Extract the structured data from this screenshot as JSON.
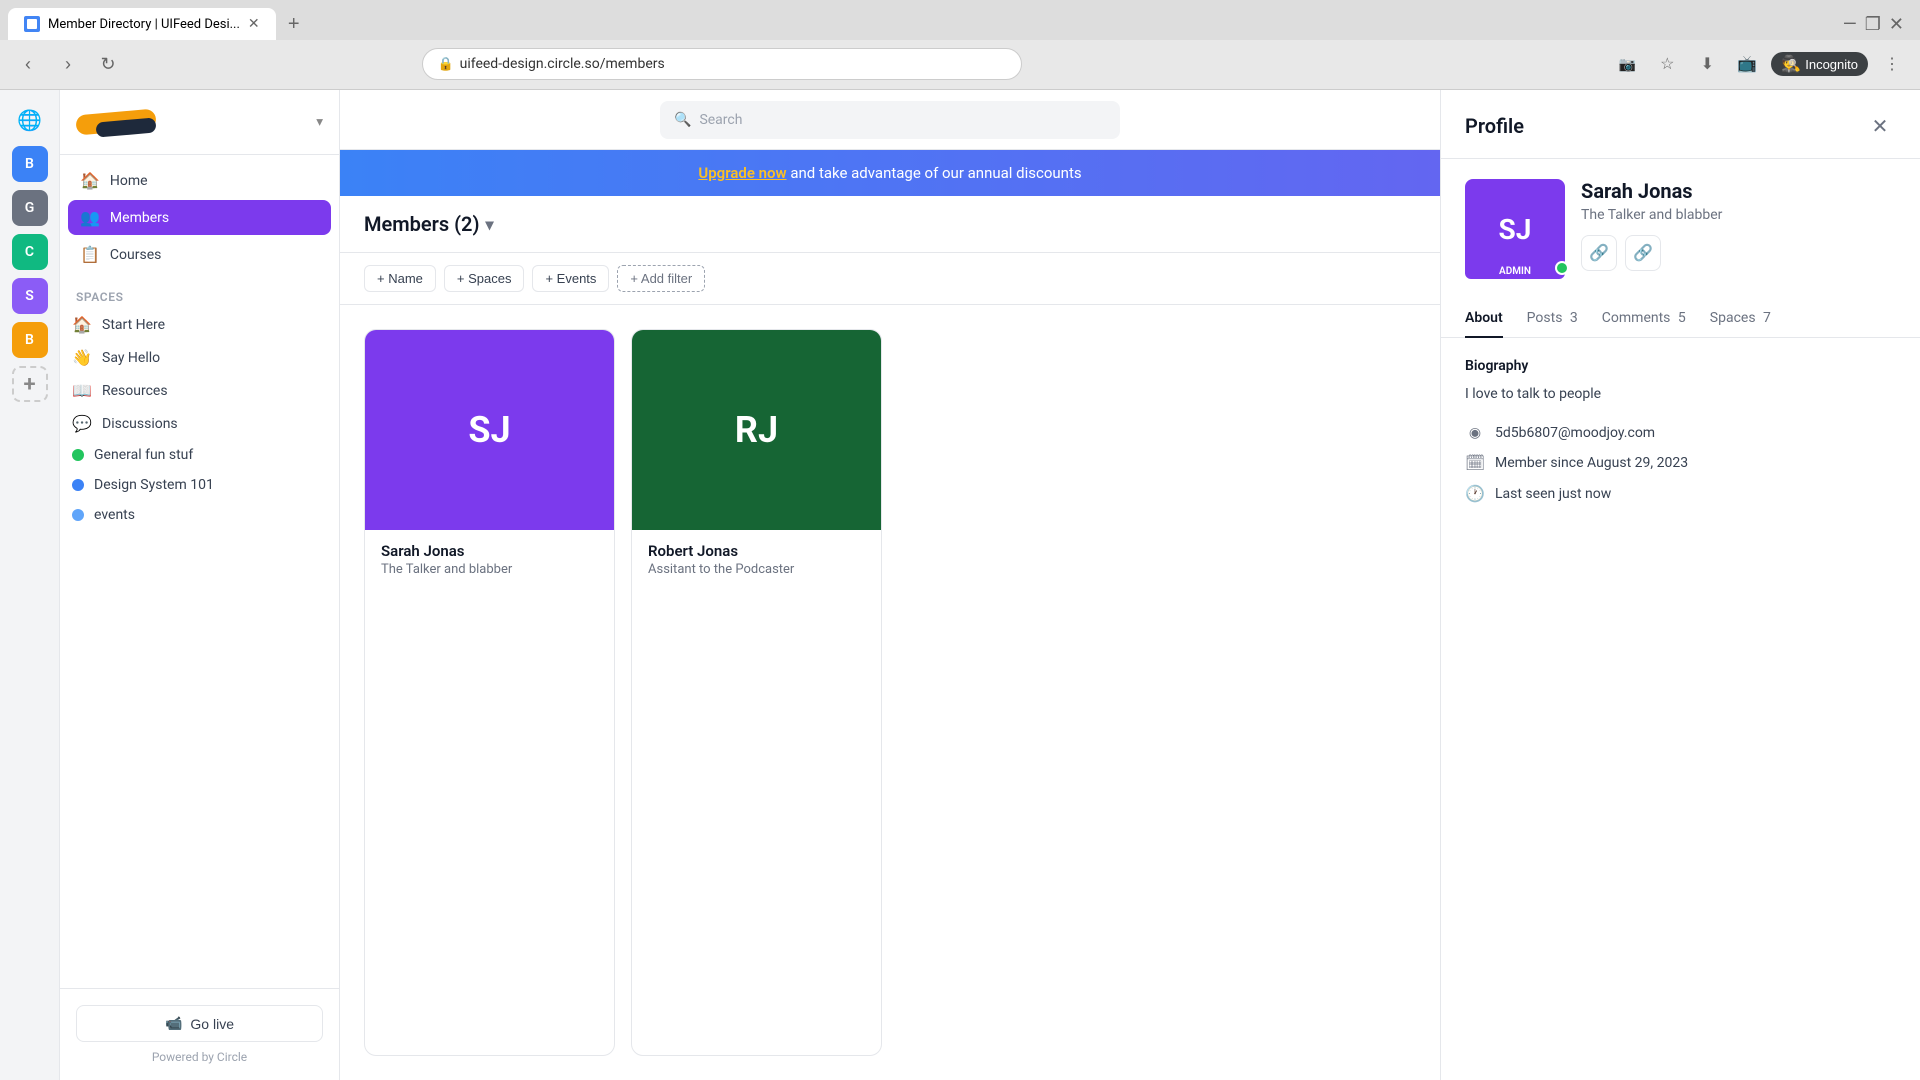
{
  "browser": {
    "tab": {
      "title": "Member Directory | UIFeed Desi...",
      "favicon": "M"
    },
    "address": "uifeed-design.circle.so/members",
    "incognito_label": "Incognito"
  },
  "sidebar": {
    "logo_alt": "UIFeed Design",
    "chevron": "▾",
    "nav": [
      {
        "id": "home",
        "label": "Home",
        "icon": "🏠",
        "active": false
      },
      {
        "id": "members",
        "label": "Members",
        "icon": "👥",
        "active": true
      },
      {
        "id": "courses",
        "label": "Courses",
        "icon": "📋",
        "active": false
      }
    ],
    "spaces_header": "Spaces",
    "spaces": [
      {
        "id": "start-here",
        "label": "Start Here",
        "icon": "🏠",
        "dot": null
      },
      {
        "id": "say-hello",
        "label": "Say Hello",
        "icon": "👋",
        "dot": null
      },
      {
        "id": "resources",
        "label": "Resources",
        "icon": "📖",
        "dot": null
      },
      {
        "id": "discussions",
        "label": "Discussions",
        "icon": "💬",
        "dot": null
      },
      {
        "id": "general",
        "label": "General fun stuf",
        "icon": null,
        "dot": "#22c55e"
      },
      {
        "id": "design-system",
        "label": "Design System 101",
        "icon": null,
        "dot": "#3b82f6"
      },
      {
        "id": "events",
        "label": "events",
        "icon": null,
        "dot": "#60a5fa"
      }
    ],
    "go_live_label": "Go live",
    "powered_by": "Powered by Circle"
  },
  "rail": [
    {
      "id": "globe",
      "label": "🌐",
      "type": "globe"
    },
    {
      "id": "b",
      "label": "B",
      "type": "b",
      "color": "#3b82f6"
    },
    {
      "id": "g",
      "label": "G",
      "type": "g",
      "color": "#6b7280"
    },
    {
      "id": "c",
      "label": "C",
      "type": "c",
      "color": "#10b981"
    },
    {
      "id": "s",
      "label": "S",
      "type": "s",
      "color": "#8b5cf6"
    },
    {
      "id": "b2",
      "label": "B",
      "type": "b2",
      "color": "#f59e0b"
    },
    {
      "id": "add",
      "label": "+",
      "type": "add"
    }
  ],
  "banner": {
    "link_text": "Upgrade now",
    "rest_text": " and take advantage of our annual discounts"
  },
  "search": {
    "placeholder": "Search"
  },
  "members": {
    "title": "Members (2)",
    "filters": [
      {
        "id": "name",
        "label": "+ Name"
      },
      {
        "id": "spaces",
        "label": "+ Spaces"
      },
      {
        "id": "events",
        "label": "+ Events"
      }
    ],
    "add_filter": "+ Add filter",
    "cards": [
      {
        "id": "sarah-jonas",
        "initials": "SJ",
        "name": "Sarah Jonas",
        "role": "The Talker and blabber",
        "bg_color": "#7c3aed"
      },
      {
        "id": "robert-jonas",
        "initials": "RJ",
        "name": "Robert Jonas",
        "role": "Assitant to the Podcaster",
        "bg_color": "#166534"
      }
    ]
  },
  "profile": {
    "panel_title": "Profile",
    "name": "Sarah Jonas",
    "subtitle": "The Talker and blabber",
    "initials": "SJ",
    "admin_badge": "ADMIN",
    "bg_color": "#7c3aed",
    "tabs": [
      {
        "id": "about",
        "label": "About",
        "active": true
      },
      {
        "id": "posts",
        "label": "Posts",
        "count": "3",
        "active": false
      },
      {
        "id": "comments",
        "label": "Comments",
        "count": "5",
        "active": false
      },
      {
        "id": "spaces",
        "label": "Spaces",
        "count": "7",
        "active": false
      }
    ],
    "biography_title": "Biography",
    "bio_text": "I love to talk to people",
    "meta": [
      {
        "id": "email",
        "icon": "●",
        "text": "5d5b6807@moodjoy.com"
      },
      {
        "id": "member_since",
        "icon": "🗓",
        "text": "Member since August 29, 2023"
      },
      {
        "id": "last_seen",
        "icon": "🕐",
        "text": "Last seen just now"
      }
    ]
  }
}
